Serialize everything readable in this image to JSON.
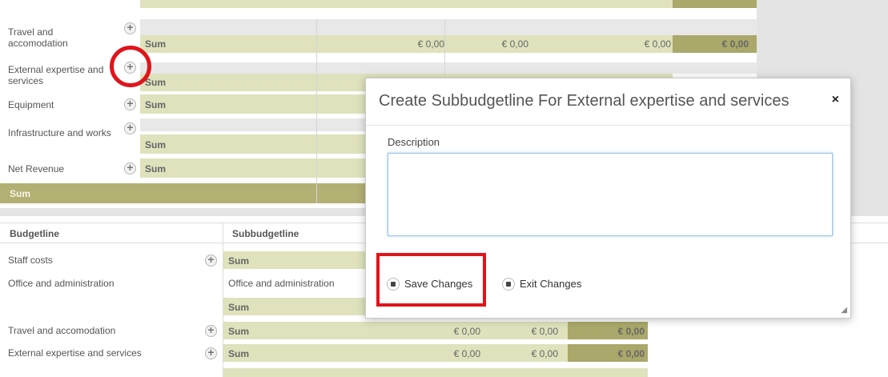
{
  "top_table": {
    "rows": [
      {
        "label": "Travel and accomodation",
        "sum": "Sum",
        "v1": "€ 0,00",
        "v2": "€ 0,00",
        "v3": "€ 0,00",
        "v4": "€ 0,00"
      },
      {
        "label": "External expertise and services",
        "sum": "Sum"
      },
      {
        "label": "Equipment",
        "sum": "Sum"
      },
      {
        "label": "Infrastructure and works",
        "sum": "Sum"
      },
      {
        "label": "Net Revenue",
        "sum": "Sum"
      }
    ],
    "total_label": "Sum"
  },
  "bottom_table": {
    "headers": {
      "budgetline": "Budgetline",
      "subbudgetline": "Subbudgetline"
    },
    "rows": [
      {
        "budgetline": "Staff costs",
        "sub": "Sum"
      },
      {
        "budgetline": "Office and administration",
        "sub": "Office and administration"
      },
      {
        "budgetline": "",
        "sub": "Sum"
      },
      {
        "budgetline": "Travel and accomodation",
        "sub": "Sum",
        "v1": "€ 0,00",
        "v2": "€ 0,00",
        "v3": "€ 0,00"
      },
      {
        "budgetline": "External expertise and services",
        "sub": "Sum",
        "v1": "€ 0,00",
        "v2": "€ 0,00",
        "v3": "€ 0,00"
      }
    ]
  },
  "modal": {
    "title": "Create Subbudgetline For External expertise and services",
    "close": "×",
    "description_label": "Description",
    "description_value": "",
    "save_label": "Save Changes",
    "exit_label": "Exit Changes"
  },
  "colors": {
    "light": "#dfe2bc",
    "olive": "#aaa86a",
    "highlight": "#e0141b"
  }
}
